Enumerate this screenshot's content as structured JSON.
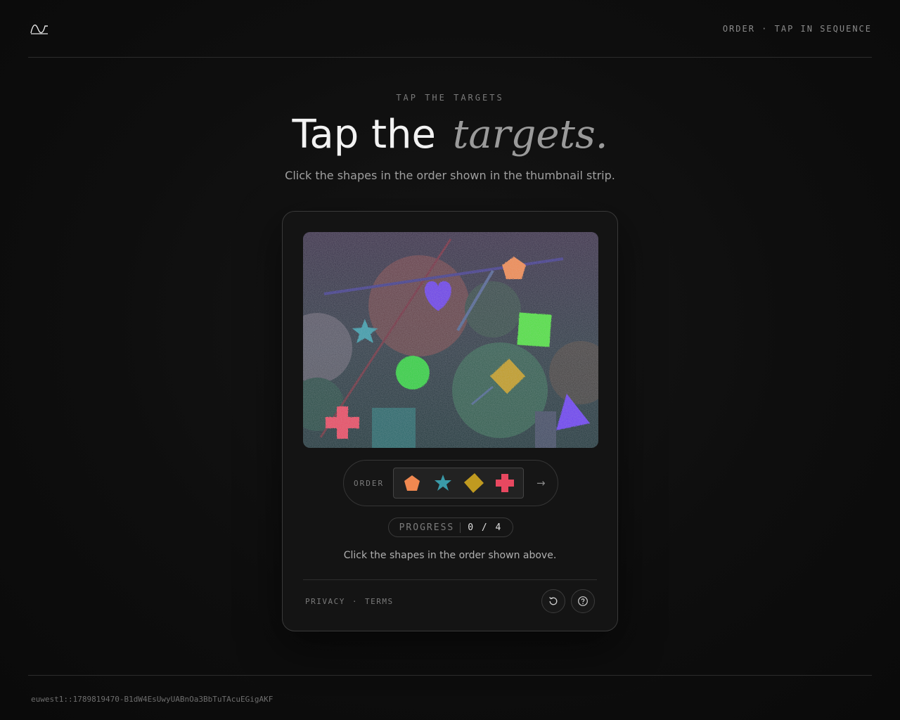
{
  "header": {
    "logo_icon": "wave-logo-icon",
    "mode_label": "ORDER · TAP IN SEQUENCE"
  },
  "hero": {
    "eyebrow": "TAP THE TARGETS",
    "title_main": "Tap the",
    "title_emph": "targets.",
    "subtitle": "Click the shapes in the order shown in the thumbnail strip."
  },
  "challenge": {
    "canvas_shapes": [
      {
        "shape": "pentagon",
        "color": "#f08850"
      },
      {
        "shape": "heart",
        "color": "#6a40e8"
      },
      {
        "shape": "square",
        "color": "#50e040"
      },
      {
        "shape": "star",
        "color": "#3a9aa8"
      },
      {
        "shape": "circle",
        "color": "#30d040"
      },
      {
        "shape": "diamond",
        "color": "#c09a20"
      },
      {
        "shape": "cross",
        "color": "#e84860"
      },
      {
        "shape": "triangle",
        "color": "#6a40f0"
      }
    ],
    "order_label": "ORDER",
    "order_sequence": [
      {
        "name": "pentagon",
        "color": "#f08850"
      },
      {
        "name": "star",
        "color": "#3a9aa8"
      },
      {
        "name": "diamond",
        "color": "#c09a20"
      },
      {
        "name": "cross",
        "color": "#e84860"
      }
    ],
    "next_arrow": "→",
    "progress_label": "PROGRESS",
    "progress_value": "0 / 4",
    "instruction": "Click the shapes in the order shown above."
  },
  "footer_links": {
    "privacy": "PRIVACY",
    "separator": "·",
    "terms": "TERMS"
  },
  "actions": {
    "reload_icon": "reload-icon",
    "help_icon": "help-icon"
  },
  "session_id": "euwest1::1789819470-B1dW4EsUwyUABnOa3BbTuTAcuEGigAKF"
}
